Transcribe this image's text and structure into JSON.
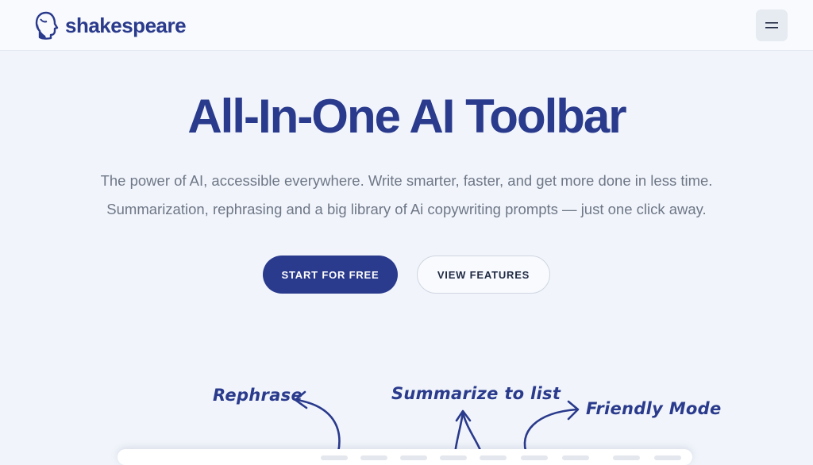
{
  "header": {
    "logo_text": "shakespeare",
    "logo_icon": "head-profile-icon",
    "menu_icon": "hamburger-menu-icon"
  },
  "hero": {
    "title": "All-In-One AI Toolbar",
    "subtitle_line1": "The power of AI, accessible everywhere. Write smarter, faster, and get more done in less time.",
    "subtitle_line2": "Summarization, rephrasing and a big library of Ai copywriting prompts — just one click away.",
    "primary_cta": "START FOR FREE",
    "secondary_cta": "VIEW FEATURES"
  },
  "annotations": {
    "rephrase": "Rephrase",
    "summarize": "Summarize to list",
    "friendly": "Friendly Mode"
  },
  "colors": {
    "brand": "#2a3a8c",
    "background": "#f1f5fb",
    "text_muted": "#6f7787"
  }
}
